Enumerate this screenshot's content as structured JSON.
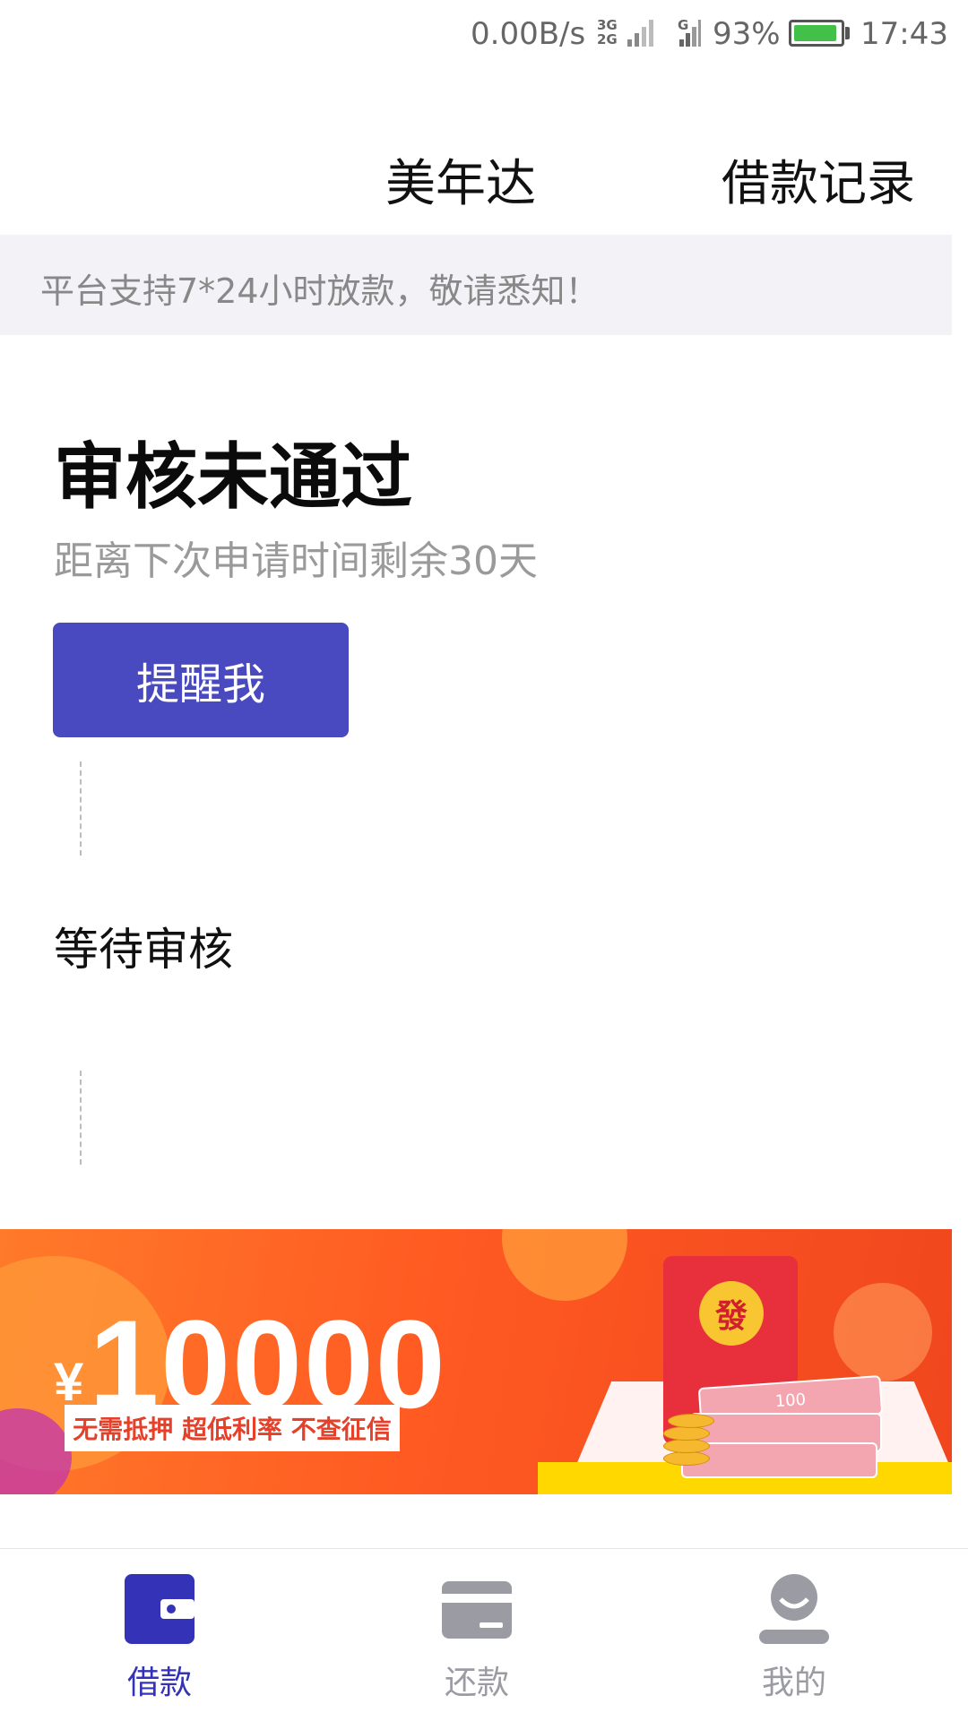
{
  "status_bar": {
    "net_speed": "0.00B/s",
    "net_types": [
      "3G",
      "2G"
    ],
    "sim2_label": "G",
    "battery_pct": "93%",
    "battery_level": 0.93,
    "time": "17:43"
  },
  "header": {
    "title": "美年达",
    "record_link": "借款记录"
  },
  "notice": "平台支持7*24小时放款，敬请悉知！",
  "status": {
    "title": "审核未通过",
    "subtitle": "距离下次申请时间剩余30天",
    "remind_button": "提醒我"
  },
  "steps": [
    "等待审核"
  ],
  "banner": {
    "currency": "¥",
    "amount": "10000",
    "tagline": "无需抵押 超低利率 不查征信",
    "emblem": "發",
    "cash_label": "100"
  },
  "tabs": [
    {
      "label": "借款",
      "icon": "wallet-icon",
      "active": true
    },
    {
      "label": "还款",
      "icon": "card-icon",
      "active": false
    },
    {
      "label": "我的",
      "icon": "person-icon",
      "active": false
    }
  ],
  "colors": {
    "accent": "#4a4ac0",
    "tab_active": "#3433b8",
    "tab_inactive": "#9b9ba3",
    "banner": "#ff5a22"
  }
}
